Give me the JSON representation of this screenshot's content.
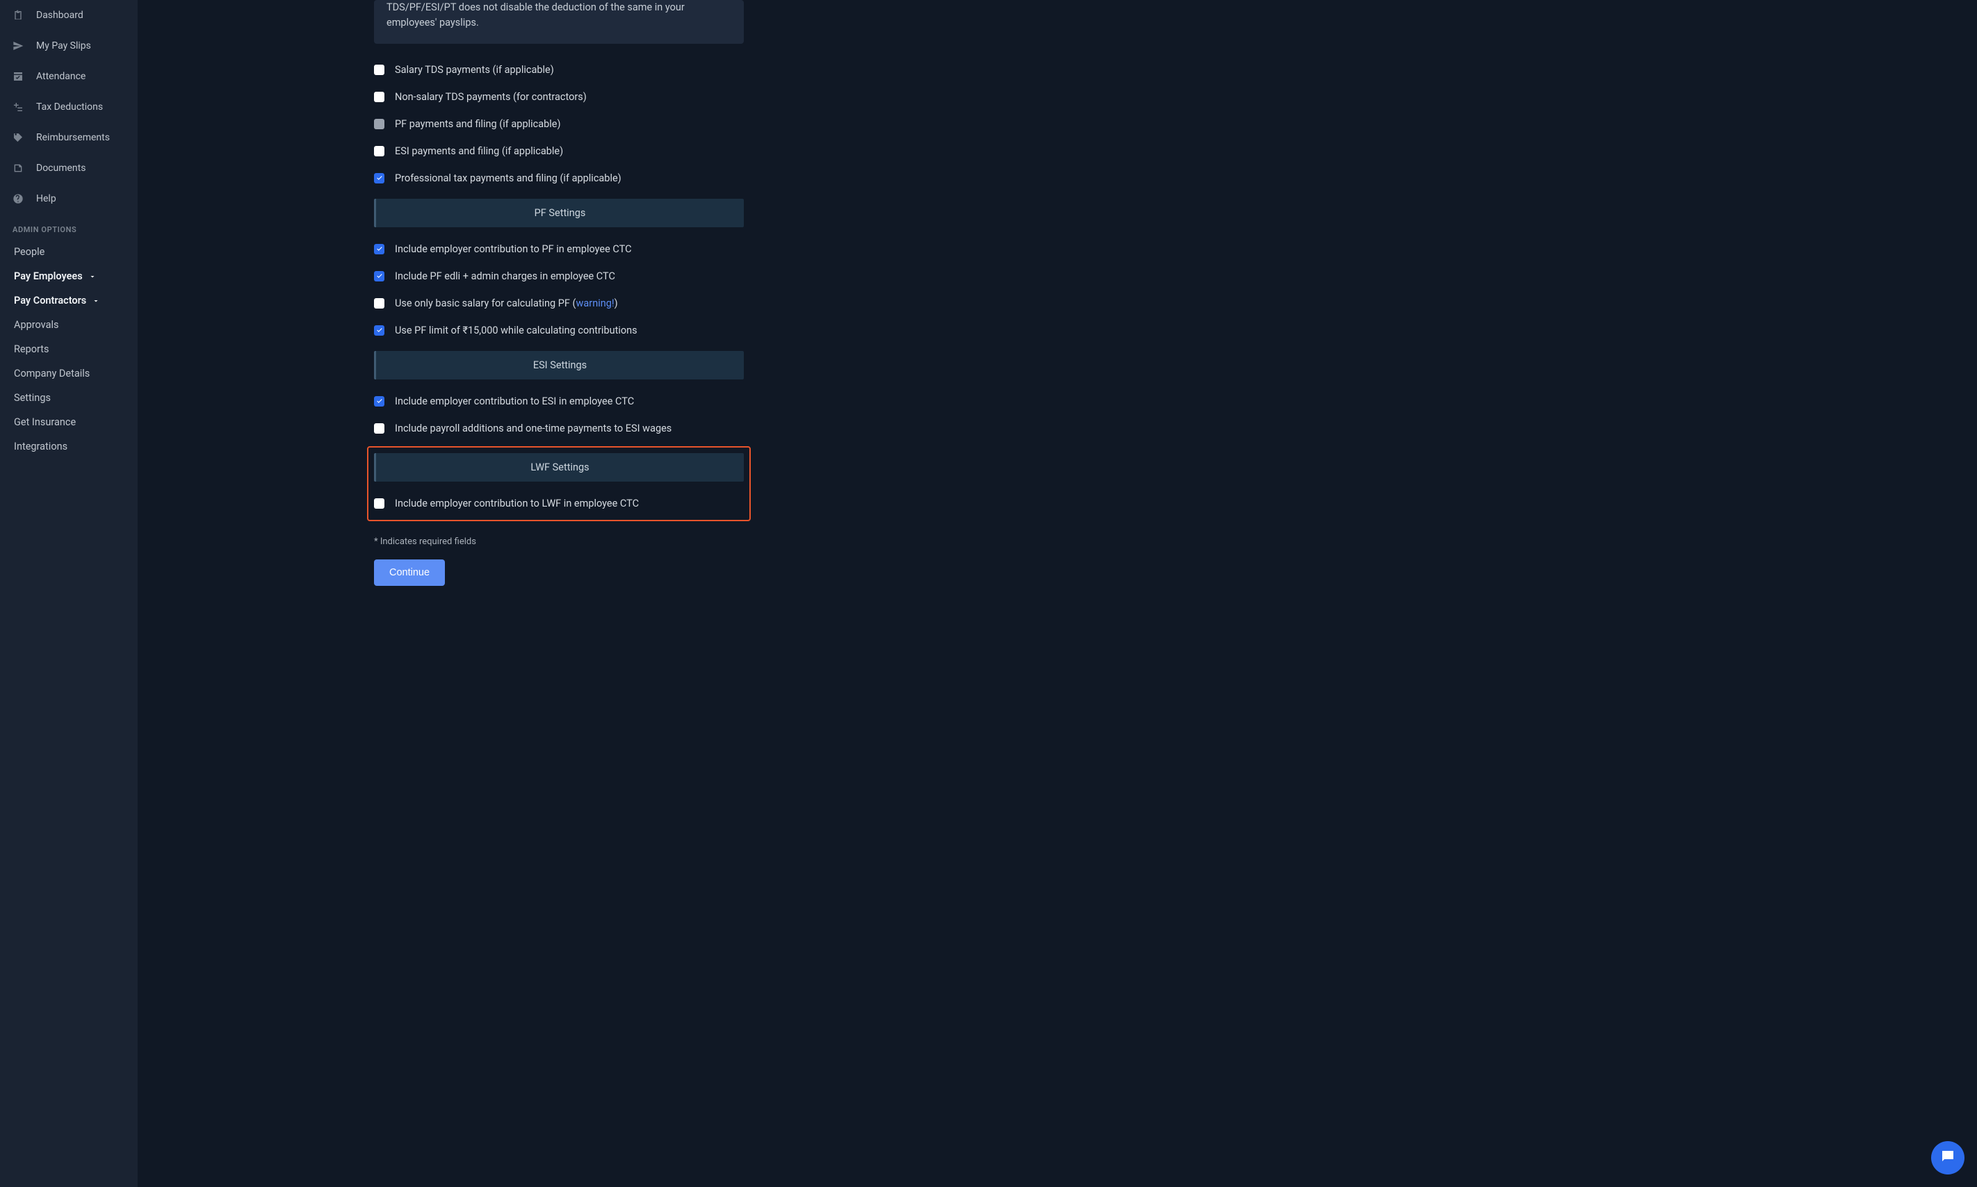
{
  "sidebar": {
    "items": [
      {
        "label": "Dashboard",
        "icon": "clipboard"
      },
      {
        "label": "My Pay Slips",
        "icon": "send"
      },
      {
        "label": "Attendance",
        "icon": "check-box"
      },
      {
        "label": "Tax Deductions",
        "icon": "plus-minus"
      },
      {
        "label": "Reimbursements",
        "icon": "tag"
      },
      {
        "label": "Documents",
        "icon": "document"
      },
      {
        "label": "Help",
        "icon": "question"
      }
    ],
    "admin_header": "ADMIN OPTIONS",
    "admin_items": [
      {
        "label": "People",
        "bold": false,
        "chevron": false
      },
      {
        "label": "Pay Employees",
        "bold": true,
        "chevron": true
      },
      {
        "label": "Pay Contractors",
        "bold": true,
        "chevron": true
      },
      {
        "label": "Approvals",
        "bold": false,
        "chevron": false
      },
      {
        "label": "Reports",
        "bold": false,
        "chevron": false
      },
      {
        "label": "Company Details",
        "bold": false,
        "chevron": false
      },
      {
        "label": "Settings",
        "bold": false,
        "chevron": false
      },
      {
        "label": "Get Insurance",
        "bold": false,
        "chevron": false
      },
      {
        "label": "Integrations",
        "bold": false,
        "chevron": false
      }
    ]
  },
  "notice": "TDS/PF/ESI/PT does not disable the deduction of the same in your employees' payslips.",
  "checkboxes_top": [
    {
      "label": "Salary TDS payments (if applicable)",
      "checked": false,
      "disabled": false
    },
    {
      "label": "Non-salary TDS payments (for contractors)",
      "checked": false,
      "disabled": false
    },
    {
      "label": "PF payments and filing (if applicable)",
      "checked": false,
      "disabled": true
    },
    {
      "label": "ESI payments and filing (if applicable)",
      "checked": false,
      "disabled": false
    },
    {
      "label": "Professional tax payments and filing (if applicable)",
      "checked": true,
      "disabled": false
    }
  ],
  "pf_section": {
    "title": "PF Settings",
    "items": [
      {
        "label": "Include employer contribution to PF in employee CTC",
        "checked": true
      },
      {
        "label": "Include PF edli + admin charges in employee CTC",
        "checked": true
      },
      {
        "label_pre": "Use only basic salary for calculating PF (",
        "link": "warning!",
        "label_post": ")",
        "checked": false
      },
      {
        "label": "Use PF limit of ₹15,000 while calculating contributions",
        "checked": true
      }
    ]
  },
  "esi_section": {
    "title": "ESI Settings",
    "items": [
      {
        "label": "Include employer contribution to ESI in employee CTC",
        "checked": true
      },
      {
        "label": "Include payroll additions and one-time payments to ESI wages",
        "checked": false
      }
    ]
  },
  "lwf_section": {
    "title": "LWF Settings",
    "items": [
      {
        "label": "Include employer contribution to LWF in employee CTC",
        "checked": false
      }
    ]
  },
  "required_note": "* Indicates required fields",
  "continue_label": "Continue"
}
